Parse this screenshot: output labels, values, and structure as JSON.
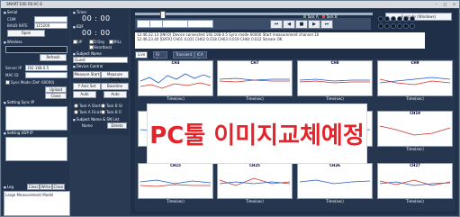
{
  "window": {
    "title": "SMART EXE RS-VC-E",
    "min": "–",
    "max": "□",
    "close": "×"
  },
  "left": {
    "serial": "Serial",
    "com_label": "COM",
    "baud_label": "BAUD RATE",
    "baud_value": "115200",
    "open": "Open",
    "wireless": "Wireless",
    "refresh": "Refresh",
    "server_ip_label": "Server IP",
    "server_ip_value": "192.168.0.5",
    "mac_label": "MAC ID",
    "sync_label": "Sync Mode (Def: 60000)",
    "upload": "Upload",
    "close": "Close",
    "setting_sync": "Setting Sync IP",
    "setting_udp": "Setting UDP IP",
    "log": "Log",
    "log_btn1": "Clear",
    "log_btn2": "Write",
    "log_btn3": "Close",
    "log_text": "Large Measurement Model"
  },
  "middle": {
    "timer": "Timer",
    "timer_value": "00 : 00",
    "edf": "EDF",
    "timer_value2": "00 : 00",
    "opt1": "UP",
    "opt2": "D:Day",
    "opt3": "MILL",
    "opt4": "Heartbeat",
    "subject_name": "Subject Name",
    "subject_value": "Guest",
    "device_control": "Device Control",
    "measure_start": "Measure Start",
    "measure_finish": "Measure Finish",
    "y_axis_set": "Y Axis Set",
    "baseline": "Baseline",
    "auto": "Auto",
    "auto2": "Auto",
    "task_a_start": "Task A Start",
    "task_b_start": "Task B St",
    "task_a_finish": "Task A Finish",
    "task_b_finish": "Task B Fi",
    "subject_name_sn": "Subject Name & SN List",
    "name": "Name",
    "delete": "Delete"
  },
  "right": {
    "task_a": "Task A",
    "task_b": "Task B",
    "execute": "Execute (Windows)",
    "log_line1": "12:46:22.13  [INFO] Device connected 192.168.0.5  Sync mode 60000  Start measurement  channel 16",
    "log_line2": "12:46:23.40  [DATA] CH01 0.021  CH02 0.018  CH03 0.019  CH04 0.022  Stream OK",
    "tabs": [
      "Live Get",
      "Fil Data",
      "Transient",
      "ICA Cap"
    ],
    "overlay": "PC툴 이미지교체예정",
    "time_label": "Time(sec)",
    "charts_top": [
      "CH3",
      "CH7",
      "CH8",
      "CH9"
    ],
    "charts_mid": [
      "CH10",
      "CH17",
      "CH18",
      "CH19"
    ],
    "charts_bot": [
      "CH15",
      "CH25",
      "CH26",
      "CH27"
    ]
  },
  "colors": {
    "panel": "#24344d",
    "overlay_text": "#e3242b",
    "task_a": "#3cbc3c",
    "task_b": "#e04a3a"
  }
}
